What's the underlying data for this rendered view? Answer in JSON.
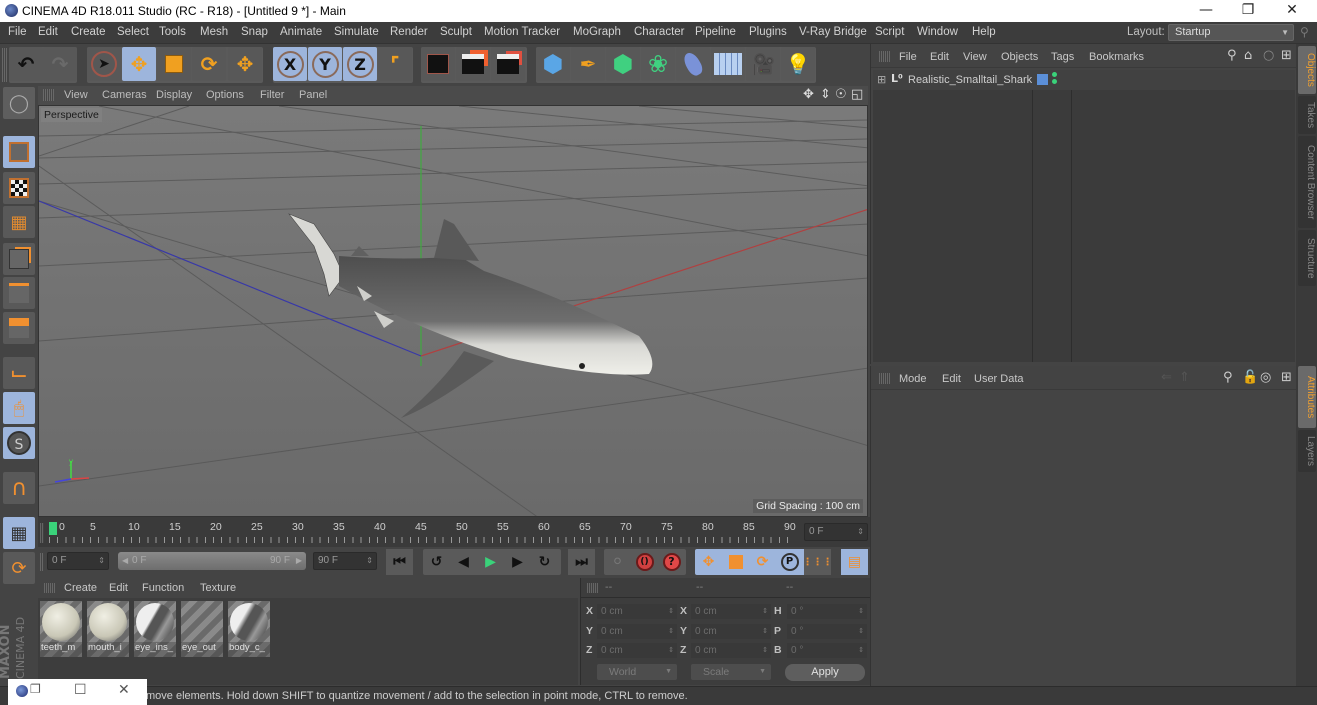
{
  "window": {
    "title": "CINEMA 4D R18.011 Studio (RC - R18) - [Untitled 9 *] - Main",
    "minimize_icon": "minimize-icon",
    "maximize_icon": "restore-icon",
    "close_icon": "close-icon"
  },
  "menubar": {
    "items": [
      "File",
      "Edit",
      "Create",
      "Select",
      "Tools",
      "Mesh",
      "Snap",
      "Animate",
      "Simulate",
      "Render",
      "Sculpt",
      "Motion Tracker",
      "MoGraph",
      "Character",
      "Pipeline",
      "Plugins",
      "V-Ray Bridge",
      "Script",
      "Window",
      "Help"
    ],
    "layout_label": "Layout:",
    "layout_value": "Startup"
  },
  "toolbar": {
    "buttons": [
      "undo",
      "redo",
      "live-selection",
      "move",
      "scale",
      "rotate",
      "recent-tool",
      "x-axis-lock",
      "y-axis-lock",
      "z-axis-lock",
      "coordinate-system",
      "render-view",
      "render-to-picture-viewer",
      "render-settings",
      "cube",
      "pen",
      "subdivision-surface",
      "cloner",
      "deformer",
      "floor",
      "camera",
      "light"
    ],
    "axis_labels": [
      "X",
      "Y",
      "Z"
    ]
  },
  "viewport": {
    "menu": [
      "View",
      "Cameras",
      "Display",
      "Options",
      "Filter",
      "Panel"
    ],
    "camera_label": "Perspective",
    "grid_spacing": "Grid Spacing : 100 cm",
    "nav_icons": [
      "move-view-icon",
      "zoom-view-icon",
      "rotate-view-icon",
      "toggle-view-icon"
    ]
  },
  "left_tools": [
    "make-editable",
    "texture-mode",
    "workplane",
    "points-mode",
    "edges-mode",
    "polygons-mode",
    "axis-mode",
    "tweak-mode",
    "solo-mode",
    "snap",
    "locked-workplane",
    "planar-workplane"
  ],
  "timeline": {
    "ticks": [
      "0",
      "5",
      "10",
      "15",
      "20",
      "25",
      "30",
      "35",
      "40",
      "45",
      "50",
      "55",
      "60",
      "65",
      "70",
      "75",
      "80",
      "85",
      "90"
    ],
    "current_frame": "0 F",
    "start_frame": "0 F",
    "range_start": "0 F",
    "range_end": "90 F",
    "end_frame": "90 F"
  },
  "materials": {
    "menu": [
      "Create",
      "Edit",
      "Function",
      "Texture"
    ],
    "items": [
      {
        "name": "teeth_m",
        "type": "plain"
      },
      {
        "name": "mouth_i",
        "type": "plain"
      },
      {
        "name": "eye_ins_",
        "type": "textured"
      },
      {
        "name": "eye_out",
        "type": "empty"
      },
      {
        "name": "body_c_",
        "type": "textured"
      }
    ]
  },
  "coordinates": {
    "headers": [
      "--",
      "--",
      "--"
    ],
    "rows": [
      {
        "l1": "X",
        "v1": "0 cm",
        "l2": "X",
        "v2": "0 cm",
        "l3": "H",
        "v3": "0 °"
      },
      {
        "l1": "Y",
        "v1": "0 cm",
        "l2": "Y",
        "v2": "0 cm",
        "l3": "P",
        "v3": "0 °"
      },
      {
        "l1": "Z",
        "v1": "0 cm",
        "l2": "Z",
        "v2": "0 cm",
        "l3": "B",
        "v3": "0 °"
      }
    ],
    "space": "World",
    "mode": "Scale",
    "apply": "Apply"
  },
  "objects_panel": {
    "menu": [
      "File",
      "Edit",
      "View",
      "Objects",
      "Tags",
      "Bookmarks"
    ],
    "objects": [
      {
        "name": "Realistic_Smalltail_Shark",
        "layer_color": "#5b8fd8"
      }
    ]
  },
  "attributes_panel": {
    "menu": [
      "Mode",
      "Edit",
      "User Data"
    ]
  },
  "side_tabs": {
    "top": [
      "Objects",
      "Takes",
      "Content Browser",
      "Structure"
    ],
    "bottom": [
      "Attributes",
      "Layers"
    ]
  },
  "brand": {
    "line1": "MAXON",
    "line2": "CINEMA 4D"
  },
  "status": {
    "text": "move elements. Hold down SHIFT to quantize movement / add to the selection in point mode, CTRL to remove."
  },
  "colors": {
    "accent_orange": "#f0a030",
    "selected_blue": "#9db5dc",
    "play_green": "#3ad27a",
    "axis_x": "#d04040",
    "axis_y": "#40c040",
    "axis_z": "#4040c0"
  }
}
